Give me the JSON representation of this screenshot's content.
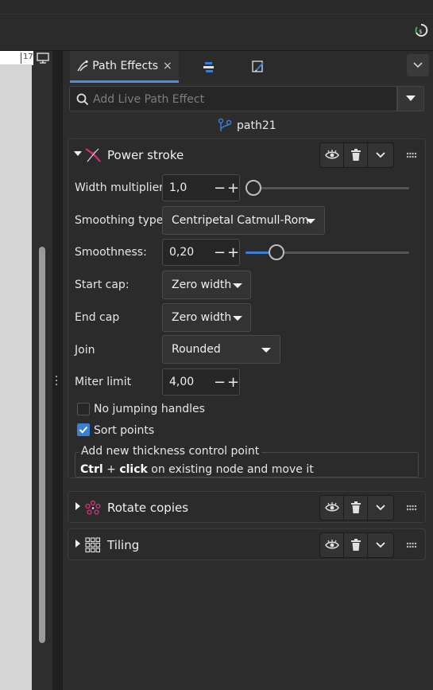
{
  "ruler": {
    "number": "17"
  },
  "dock": {
    "tabs": [
      {
        "label": "Path Effects",
        "close": "×",
        "active": true
      },
      {
        "icon": "align-distribute-icon",
        "active": false
      },
      {
        "icon": "fill-stroke-icon",
        "active": false
      }
    ]
  },
  "search": {
    "placeholder": "Add Live Path Effect"
  },
  "path": {
    "name": "path21"
  },
  "effects": {
    "power_stroke": {
      "title": "Power stroke",
      "expanded": true,
      "width_multiplier": {
        "label": "Width multiplier",
        "value": "1,0",
        "slider_fraction": 0.0
      },
      "smoothing_type": {
        "label": "Smoothing type",
        "value": "Centripetal Catmull-Rom"
      },
      "smoothness": {
        "label": "Smoothness:",
        "value": "0,20",
        "slider_fraction": 0.2
      },
      "start_cap": {
        "label": "Start cap:",
        "value": "Zero width"
      },
      "end_cap": {
        "label": "End cap",
        "value": "Zero width"
      },
      "join": {
        "label": "Join",
        "value": "Rounded"
      },
      "miter_limit": {
        "label": "Miter limit",
        "value": "4,00"
      },
      "no_jumping_handles": {
        "label": "No jumping handles",
        "checked": false
      },
      "sort_points": {
        "label": "Sort points",
        "checked": true
      },
      "hint": {
        "title": "Add new thickness control point",
        "key1": "Ctrl",
        "plus": " + ",
        "key2": "click",
        "rest": " on existing node and move it"
      }
    },
    "rotate_copies": {
      "title": "Rotate copies",
      "expanded": false
    },
    "tiling": {
      "title": "Tiling",
      "expanded": false
    }
  },
  "spin_symbols": {
    "minus": "−",
    "plus": "+"
  },
  "colors": {
    "accent": "#3c7ed6",
    "power_icon": "#d0307a",
    "path_icon": "#3c7ed6"
  }
}
